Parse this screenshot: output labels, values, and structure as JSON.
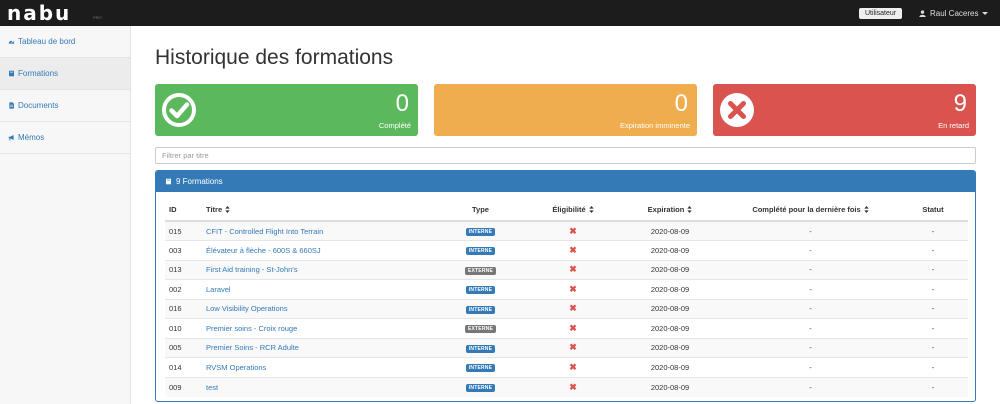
{
  "app": {
    "logo": "nabu",
    "logo_sup": "PRO"
  },
  "header": {
    "role_badge": "Utilisateur",
    "user_name": "Raul Caceres"
  },
  "sidebar": {
    "items": [
      {
        "label": "Tableau de bord",
        "icon": "dashboard-icon"
      },
      {
        "label": "Formations",
        "icon": "book-icon",
        "active": true
      },
      {
        "label": "Documents",
        "icon": "file-icon"
      },
      {
        "label": "Mémos",
        "icon": "bullhorn-icon"
      }
    ]
  },
  "page": {
    "title": "Historique des formations"
  },
  "stats": [
    {
      "value": "0",
      "label": "Complété",
      "color": "#5cb85c",
      "icon": "check-circle-icon"
    },
    {
      "value": "0",
      "label": "Expiration imminente",
      "color": "#f0ad4e"
    },
    {
      "value": "9",
      "label": "En retard",
      "color": "#d9534f",
      "icon": "x-circle-icon"
    }
  ],
  "filter": {
    "placeholder": "Filtrer par titre",
    "value": ""
  },
  "panel": {
    "title": "9 Formations",
    "color": "#337ab7"
  },
  "table": {
    "headers": {
      "id": "ID",
      "title": "Titre",
      "type": "Type",
      "eligibility": "Éligibilité",
      "expiration": "Expiration",
      "completed": "Complété pour la dernière fois",
      "status": "Statut"
    },
    "rows": [
      {
        "id": "015",
        "title": "CFIT - Controlled Flight Into Terrain",
        "type": "INTERNE",
        "expiration": "2020-08-09",
        "completed": "-",
        "status": "-"
      },
      {
        "id": "003",
        "title": "Élévateur à flèche - 600S & 660SJ",
        "type": "INTERNE",
        "expiration": "2020-08-09",
        "completed": "-",
        "status": "-"
      },
      {
        "id": "013",
        "title": "First Aid training - St-John's",
        "type": "EXTERNE",
        "expiration": "2020-08-09",
        "completed": "-",
        "status": "-"
      },
      {
        "id": "002",
        "title": "Laravel",
        "type": "INTERNE",
        "expiration": "2020-08-09",
        "completed": "-",
        "status": "-"
      },
      {
        "id": "016",
        "title": "Low Visibility Operations",
        "type": "INTERNE",
        "expiration": "2020-08-09",
        "completed": "-",
        "status": "-"
      },
      {
        "id": "010",
        "title": "Premier soins - Croix rouge",
        "type": "EXTERNE",
        "expiration": "2020-08-09",
        "completed": "-",
        "status": "-"
      },
      {
        "id": "005",
        "title": "Premier Soins - RCR Adulte",
        "type": "INTERNE",
        "expiration": "2020-08-09",
        "completed": "-",
        "status": "-"
      },
      {
        "id": "014",
        "title": "RVSM Operations",
        "type": "INTERNE",
        "expiration": "2020-08-09",
        "completed": "-",
        "status": "-"
      },
      {
        "id": "009",
        "title": "test",
        "type": "INTERNE",
        "expiration": "2020-08-09",
        "completed": "-",
        "status": "-"
      }
    ]
  }
}
